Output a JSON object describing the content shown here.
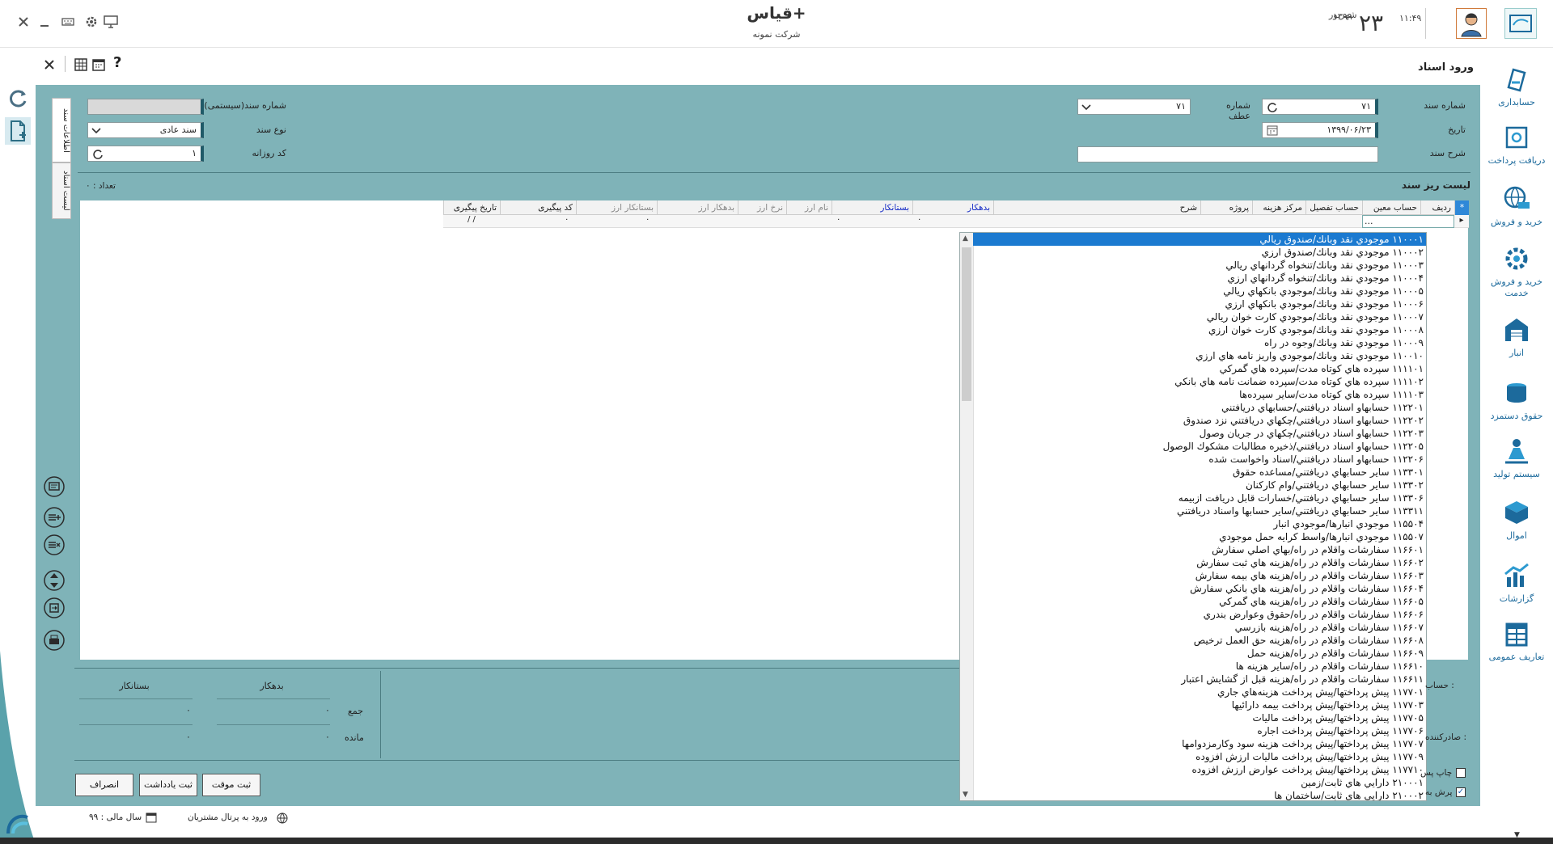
{
  "app": {
    "title": "قیاس+",
    "company": "شرکت نمونه"
  },
  "clock": {
    "time": "۱۱:۴۹",
    "day": "۲۳",
    "month": "شهریور",
    "year": "۱۳۹۹"
  },
  "page": {
    "heading": "ورود اسناد"
  },
  "sidebar": {
    "items": [
      {
        "label": "حسابداری",
        "icon": "accounting-icon"
      },
      {
        "label": "دریافت پرداخت",
        "icon": "payment-icon"
      },
      {
        "label": "خرید و فروش",
        "icon": "globe-truck-icon"
      },
      {
        "label": "خرید و فروش خدمت",
        "icon": "gear-service-icon"
      },
      {
        "label": "انبار",
        "icon": "warehouse-icon"
      },
      {
        "label": "حقوق دستمزد",
        "icon": "coins-icon"
      },
      {
        "label": "سیستم تولید",
        "icon": "worker-icon"
      },
      {
        "label": "اموال",
        "icon": "boxes-icon"
      },
      {
        "label": "گزارشات",
        "icon": "chart-icon"
      },
      {
        "label": "تعاریف عمومی",
        "icon": "table-icon"
      }
    ]
  },
  "tabs": {
    "doc_info": "اطلاعات سند",
    "doc_list": "لیست اسناد"
  },
  "form": {
    "doc_number_label": "شماره سند",
    "doc_number_value": "۷۱",
    "ref_number_label": "شماره عطف",
    "ref_number_value": "۷۱",
    "date_label": "تاریخ",
    "date_value": "۱۳۹۹/۰۶/۲۳",
    "description_label": "شرح سند",
    "description_value": "",
    "system_number_label": "شماره سند(سیستمی)",
    "system_number_value": "",
    "doc_type_label": "نوع سند",
    "doc_type_value": "سند عادی",
    "daily_code_label": "کد روزانه",
    "daily_code_value": "۱"
  },
  "grid": {
    "title": "لیست ریز سند",
    "count_label": "تعداد : ۰",
    "columns": [
      "ردیف",
      "حساب معین",
      "حساب تفصیل",
      "مرکز هزینه",
      "پروژه",
      "شرح",
      "بدهکار",
      "بستانکار",
      "نام ارز",
      "نرخ ارز",
      "بدهکار ارز",
      "بستانکار ارز",
      "کد پیگیری",
      "تاریخ پیگیری"
    ],
    "row1": {
      "cell": "...",
      "debit": "۰",
      "credit": "۰",
      "debit_fx": "۰",
      "credit_fx": "۰",
      "follow_date": "/ /"
    }
  },
  "dropdown": {
    "items": [
      "۱۱۰۰۰۱ موجودي نقد وبانك/صندوق ريالي",
      "۱۱۰۰۰۲ موجودي نقد وبانك/صندوق ارزي",
      "۱۱۰۰۰۳ موجودي نقد وبانك/تنخواه گردانهاي ريالي",
      "۱۱۰۰۰۴ موجودي نقد وبانك/تنخواه گردانهاي ارزي",
      "۱۱۰۰۰۵ موجودي نقد وبانك/موجودي بانكهاي ريالي",
      "۱۱۰۰۰۶ موجودي نقد وبانك/موجودي بانكهاي ارزي",
      "۱۱۰۰۰۷ موجودي نقد وبانك/موجودي كارت خوان ريالي",
      "۱۱۰۰۰۸ موجودي نقد وبانك/موجودي كارت خوان ارزي",
      "۱۱۰۰۰۹ موجودي نقد وبانك/وجوه در راه",
      "۱۱۰۰۱۰ موجودي نقد وبانك/موجودي واريز نامه هاي ارزي",
      "۱۱۱۱۰۱ سپرده هاي كوتاه مدت/سپرده هاي گمركي",
      "۱۱۱۱۰۲ سپرده هاي كوتاه مدت/سپرده ضمانت نامه هاي بانكي",
      "۱۱۱۱۰۳ سپرده هاي كوتاه مدت/ساير سپرده‌ها",
      "۱۱۲۲۰۱ حسابهاو اسناد دريافتني/حسابهاي دريافتني",
      "۱۱۲۲۰۲ حسابهاو اسناد دريافتني/چكهاي دريافتني نزد صندوق",
      "۱۱۲۲۰۳ حسابهاو اسناد دريافتني/چكهاي در جريان وصول",
      "۱۱۲۲۰۵ حسابهاو اسناد دريافتني/ذخيره مطالبات مشكوك الوصول",
      "۱۱۲۲۰۶ حسابهاو اسناد دريافتني/اسناد واخواست شده",
      "۱۱۳۳۰۱ ساير حسابهاي دريافتني/مساعده حقوق",
      "۱۱۳۳۰۲ ساير حسابهاي دريافتني/وام كاركنان",
      "۱۱۳۳۰۶ ساير حسابهاي دريافتني/خسارات قابل دريافت ازبيمه",
      "۱۱۳۳۱۱ ساير حسابهاي دريافتني/ساير حسابها واسناد دريافتني",
      "۱۱۵۵۰۴ موجودي انبارها/موجودي انبار",
      "۱۱۵۵۰۷ موجودي انبارها/واسط كرايه حمل موجودي",
      "۱۱۶۶۰۱ سفارشات واقلام در راه/بهاي اصلي سفارش",
      "۱۱۶۶۰۲ سفارشات واقلام در راه/هزينه هاي ثبت سفارش",
      "۱۱۶۶۰۳ سفارشات واقلام در راه/هزينه هاي بيمه سفارش",
      "۱۱۶۶۰۴ سفارشات واقلام در راه/هزينه هاي بانكي سفارش",
      "۱۱۶۶۰۵ سفارشات واقلام در راه/هزينه هاي گمركي",
      "۱۱۶۶۰۶ سفارشات واقلام در راه/حقوق وعوارض بندري",
      "۱۱۶۶۰۷ سفارشات واقلام در راه/هزينه بازرسي",
      "۱۱۶۶۰۸ سفارشات واقلام در راه/هزينه حق العمل ترخيص",
      "۱۱۶۶۰۹ سفارشات واقلام در راه/هزينه حمل",
      "۱۱۶۶۱۰ سفارشات واقلام در راه/ساير هزينه ها",
      "۱۱۶۶۱۱ سفارشات واقلام در راه/هزينه قبل از گشايش اعتبار",
      "۱۱۷۷۰۱ پيش پرداختها/پيش پرداخت هزينه‌هاي جاري",
      "۱۱۷۷۰۳ پيش پرداختها/پيش پرداخت بيمه دارائيها",
      "۱۱۷۷۰۵ پيش پرداختها/پيش پرداخت ماليات",
      "۱۱۷۷۰۶ پيش پرداختها/پيش پرداخت اجاره",
      "۱۱۷۷۰۷ پيش پرداختها/پيش پرداخت هزينه سود وكارمزدوامها",
      "۱۱۷۷۰۹ پيش پرداختها/پيش پرداخت ماليات ارزش افزوده",
      "۱۱۷۷۱۰ پيش پرداختها/پيش پرداخت عوارض ارزش افزوده",
      "۲۱۰۰۰۱ دارايي هاي ثابت/زمين",
      "۲۱۰۰۰۲ دارايي هاي ثابت/ساختمان ها"
    ]
  },
  "side_labels": {
    "account": "حساب :",
    "issuer": "صادرکننده :",
    "print_after": "چاپ پس",
    "jump_to": "پرش به"
  },
  "totals": {
    "creditor_header": "بستانکار",
    "debtor_header": "بدهکار",
    "sum_label": "جمع",
    "remain_label": "مانده",
    "sum_creditor": "۰",
    "sum_debtor": "۰",
    "remain_creditor": "۰",
    "remain_debtor": "۰"
  },
  "buttons": {
    "temp_save": "ثبت موقت",
    "note_save": "ثبت يادداشت",
    "cancel": "انصراف"
  },
  "footer": {
    "portal": "ورود به پرتال مشتریان",
    "fiscal_year": "سال مالی : ۹۹"
  },
  "colors": {
    "panel": "#7fb3b8",
    "selection": "#1b7ad0",
    "sidebar_text": "#1c6a9c"
  }
}
